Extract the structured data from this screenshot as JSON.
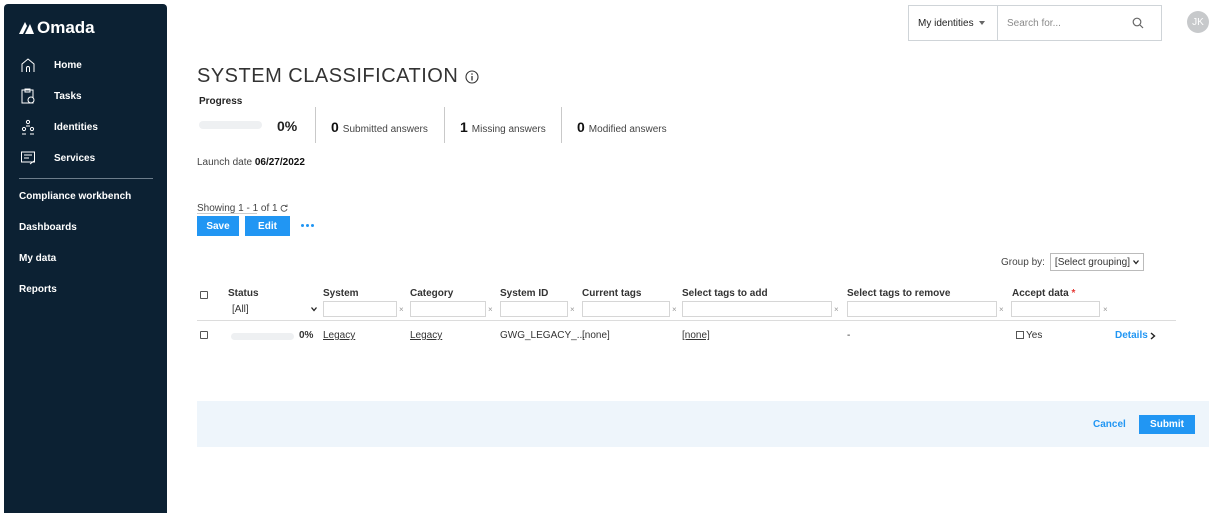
{
  "sidebar": {
    "brand": "Omada",
    "items": [
      {
        "label": "Home",
        "icon": "home-icon"
      },
      {
        "label": "Tasks",
        "icon": "tasks-icon"
      },
      {
        "label": "Identities",
        "icon": "identities-icon"
      },
      {
        "label": "Services",
        "icon": "services-icon"
      }
    ],
    "links": [
      "Compliance workbench",
      "Dashboards",
      "My data",
      "Reports"
    ]
  },
  "topbar": {
    "dropdown_label": "My identities",
    "search_placeholder": "Search for...",
    "avatar_initials": "JK"
  },
  "page": {
    "title": "SYSTEM CLASSIFICATION",
    "progress_label": "Progress",
    "progress_value": 0,
    "progress_pct": "0%",
    "stats": [
      {
        "count": "0",
        "label": "Submitted answers"
      },
      {
        "count": "1",
        "label": "Missing answers"
      },
      {
        "count": "0",
        "label": "Modified answers"
      }
    ],
    "launch_label": "Launch date",
    "launch_date": "06/27/2022",
    "showing": "Showing 1 - 1 of 1",
    "save_label": "Save",
    "edit_label": "Edit",
    "group_by_label": "Group by:",
    "group_by_value": "[Select grouping]"
  },
  "table": {
    "headers": [
      "Status",
      "System",
      "Category",
      "System ID",
      "Current tags",
      "Select tags to add",
      "Select tags to remove",
      "Accept data"
    ],
    "status_filter": "[All]",
    "filter_clear": "×",
    "row": {
      "progress_value": 0,
      "pct": "0%",
      "system": "Legacy",
      "category": "Legacy",
      "system_id": "GWG_LEGACY_...",
      "current_tags": "[none]",
      "tags_to_add": "[none]",
      "tags_to_remove": "-",
      "accept_label": "Yes",
      "details_label": "Details"
    }
  },
  "footer": {
    "cancel_label": "Cancel",
    "submit_label": "Submit"
  },
  "colors": {
    "sidebar_bg": "#0c2133",
    "accent": "#2196f3",
    "footer_bg": "#eef5fb",
    "required": "#e53935"
  }
}
